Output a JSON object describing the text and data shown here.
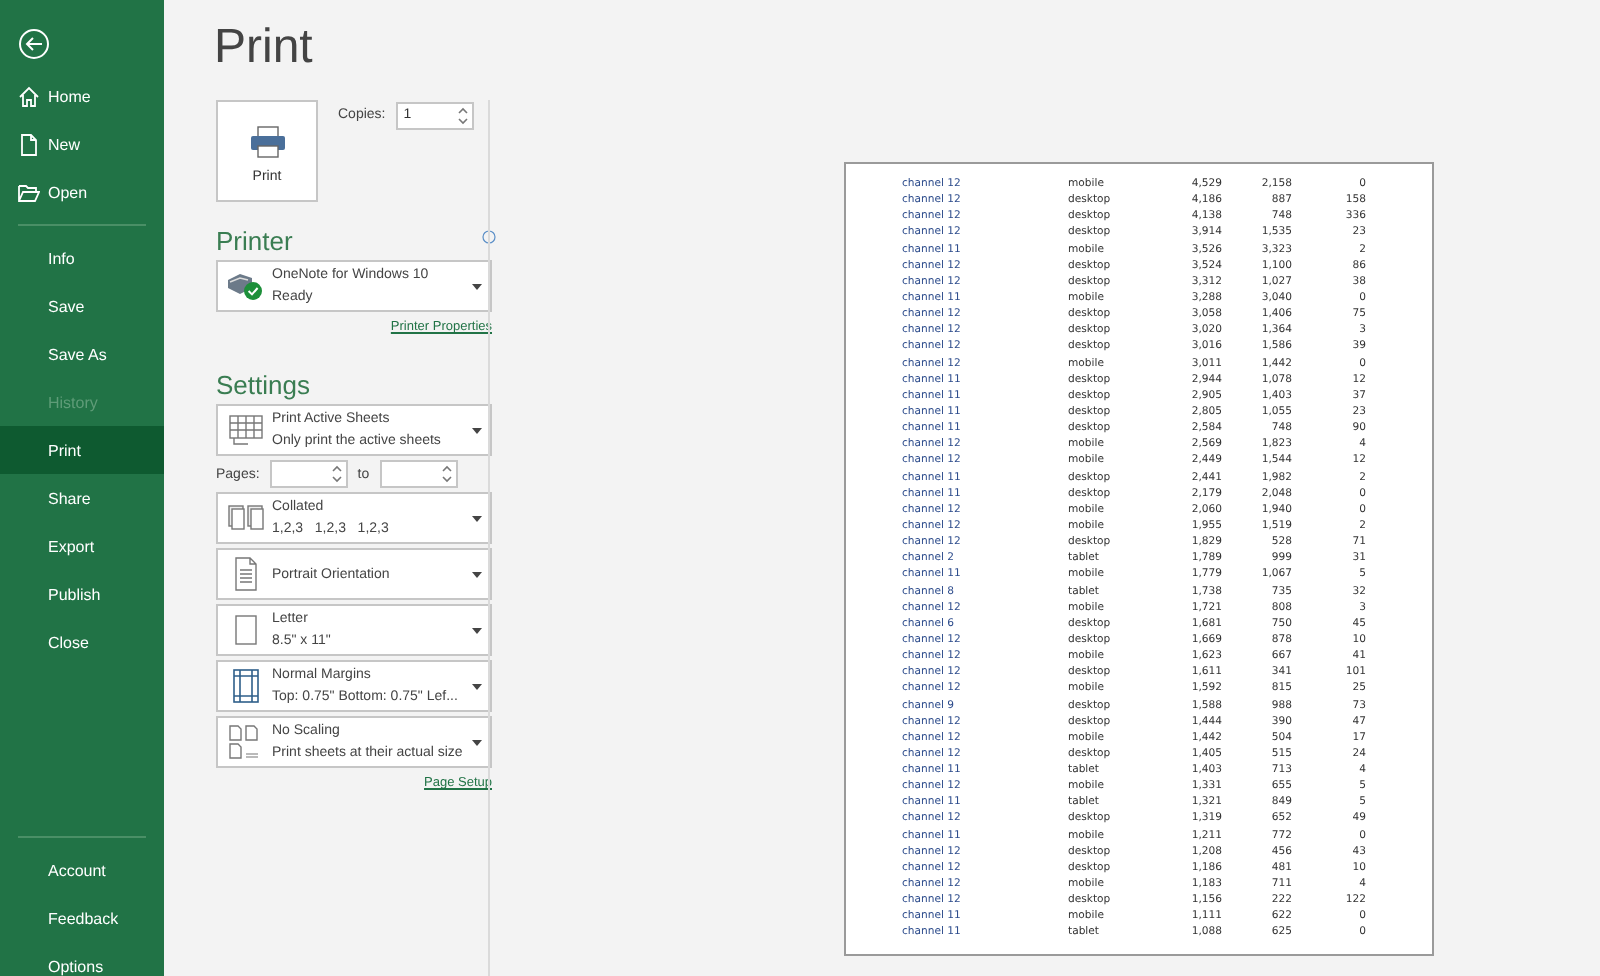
{
  "sidebar": {
    "items": [
      {
        "label": "Home",
        "kind": "home",
        "selected": false,
        "disabled": false
      },
      {
        "label": "New",
        "kind": "new",
        "selected": false,
        "disabled": false
      },
      {
        "label": "Open",
        "kind": "open",
        "selected": false,
        "disabled": false
      },
      {
        "label": "Info",
        "kind": "plain",
        "selected": false,
        "disabled": false
      },
      {
        "label": "Save",
        "kind": "plain",
        "selected": false,
        "disabled": false
      },
      {
        "label": "Save As",
        "kind": "plain",
        "selected": false,
        "disabled": false
      },
      {
        "label": "History",
        "kind": "plain",
        "selected": false,
        "disabled": true
      },
      {
        "label": "Print",
        "kind": "plain",
        "selected": true,
        "disabled": false
      },
      {
        "label": "Share",
        "kind": "plain",
        "selected": false,
        "disabled": false
      },
      {
        "label": "Export",
        "kind": "plain",
        "selected": false,
        "disabled": false
      },
      {
        "label": "Publish",
        "kind": "plain",
        "selected": false,
        "disabled": false
      },
      {
        "label": "Close",
        "kind": "plain",
        "selected": false,
        "disabled": false
      }
    ],
    "footer_items": [
      {
        "label": "Account",
        "selected": false
      },
      {
        "label": "Feedback",
        "selected": false
      },
      {
        "label": "Options",
        "selected": false
      }
    ]
  },
  "title": "Print",
  "print_button": {
    "label": "Print"
  },
  "copies": {
    "label": "Copies:",
    "value": "1"
  },
  "printer": {
    "heading": "Printer",
    "name": "OneNote for Windows 10",
    "status": "Ready",
    "link": "Printer Properties"
  },
  "settings": {
    "heading": "Settings",
    "options": [
      {
        "kind": "sheets",
        "line1": "Print Active Sheets",
        "line2": "Only print the active sheets"
      },
      {
        "kind": "pages",
        "label": "Pages:",
        "to_label": "to"
      },
      {
        "kind": "collated",
        "line1": "Collated",
        "line2": "1,2,3   1,2,3   1,2,3"
      },
      {
        "kind": "portrait",
        "line1": "Portrait Orientation"
      },
      {
        "kind": "letter",
        "line1": "Letter",
        "line2": "8.5\" x 11\""
      },
      {
        "kind": "margins",
        "line1": "Normal Margins",
        "line2": "Top: 0.75\" Bottom: 0.75\" Lef..."
      },
      {
        "kind": "scaling",
        "line1": "No Scaling",
        "line2": "Print sheets at their actual size"
      }
    ],
    "link": "Page Setup"
  },
  "preview": {
    "rows": [
      [
        "channel 12",
        "mobile",
        "4,529",
        "2,158",
        "0"
      ],
      [
        "channel 12",
        "desktop",
        "4,186",
        "887",
        "158"
      ],
      [
        "channel 12",
        "desktop",
        "4,138",
        "748",
        "336"
      ],
      [
        "channel 12",
        "desktop",
        "3,914",
        "1,535",
        "23"
      ],
      [
        "channel 11",
        "mobile",
        "3,526",
        "3,323",
        "2"
      ],
      [
        "channel 12",
        "desktop",
        "3,524",
        "1,100",
        "86"
      ],
      [
        "channel 12",
        "desktop",
        "3,312",
        "1,027",
        "38"
      ],
      [
        "channel 11",
        "mobile",
        "3,288",
        "3,040",
        "0"
      ],
      [
        "channel 12",
        "desktop",
        "3,058",
        "1,406",
        "75"
      ],
      [
        "channel 12",
        "desktop",
        "3,020",
        "1,364",
        "3"
      ],
      [
        "channel 12",
        "desktop",
        "3,016",
        "1,586",
        "39"
      ],
      [
        "channel 12",
        "mobile",
        "3,011",
        "1,442",
        "0"
      ],
      [
        "channel 11",
        "desktop",
        "2,944",
        "1,078",
        "12"
      ],
      [
        "channel 11",
        "desktop",
        "2,905",
        "1,403",
        "37"
      ],
      [
        "channel 11",
        "desktop",
        "2,805",
        "1,055",
        "23"
      ],
      [
        "channel 11",
        "desktop",
        "2,584",
        "748",
        "90"
      ],
      [
        "channel 12",
        "mobile",
        "2,569",
        "1,823",
        "4"
      ],
      [
        "channel 12",
        "mobile",
        "2,449",
        "1,544",
        "12"
      ],
      [
        "channel 11",
        "desktop",
        "2,441",
        "1,982",
        "2"
      ],
      [
        "channel 11",
        "desktop",
        "2,179",
        "2,048",
        "0"
      ],
      [
        "channel 12",
        "mobile",
        "2,060",
        "1,940",
        "0"
      ],
      [
        "channel 12",
        "mobile",
        "1,955",
        "1,519",
        "2"
      ],
      [
        "channel 12",
        "desktop",
        "1,829",
        "528",
        "71"
      ],
      [
        "channel 2",
        "tablet",
        "1,789",
        "999",
        "31"
      ],
      [
        "channel 11",
        "mobile",
        "1,779",
        "1,067",
        "5"
      ],
      [
        "channel 8",
        "tablet",
        "1,738",
        "735",
        "32"
      ],
      [
        "channel 12",
        "mobile",
        "1,721",
        "808",
        "3"
      ],
      [
        "channel 6",
        "desktop",
        "1,681",
        "750",
        "45"
      ],
      [
        "channel 12",
        "desktop",
        "1,669",
        "878",
        "10"
      ],
      [
        "channel 12",
        "mobile",
        "1,623",
        "667",
        "41"
      ],
      [
        "channel 12",
        "desktop",
        "1,611",
        "341",
        "101"
      ],
      [
        "channel 12",
        "mobile",
        "1,592",
        "815",
        "25"
      ],
      [
        "channel 9",
        "desktop",
        "1,588",
        "988",
        "73"
      ],
      [
        "channel 12",
        "desktop",
        "1,444",
        "390",
        "47"
      ],
      [
        "channel 12",
        "mobile",
        "1,442",
        "504",
        "17"
      ],
      [
        "channel 12",
        "desktop",
        "1,405",
        "515",
        "24"
      ],
      [
        "channel 11",
        "tablet",
        "1,403",
        "713",
        "4"
      ],
      [
        "channel 12",
        "mobile",
        "1,331",
        "655",
        "5"
      ],
      [
        "channel 11",
        "tablet",
        "1,321",
        "849",
        "5"
      ],
      [
        "channel 12",
        "desktop",
        "1,319",
        "652",
        "49"
      ],
      [
        "channel 11",
        "mobile",
        "1,211",
        "772",
        "0"
      ],
      [
        "channel 12",
        "desktop",
        "1,208",
        "456",
        "43"
      ],
      [
        "channel 12",
        "desktop",
        "1,186",
        "481",
        "10"
      ],
      [
        "channel 12",
        "mobile",
        "1,183",
        "711",
        "4"
      ],
      [
        "channel 12",
        "desktop",
        "1,156",
        "222",
        "122"
      ],
      [
        "channel 11",
        "mobile",
        "1,111",
        "622",
        "0"
      ],
      [
        "channel 11",
        "tablet",
        "1,088",
        "625",
        "0"
      ]
    ]
  }
}
